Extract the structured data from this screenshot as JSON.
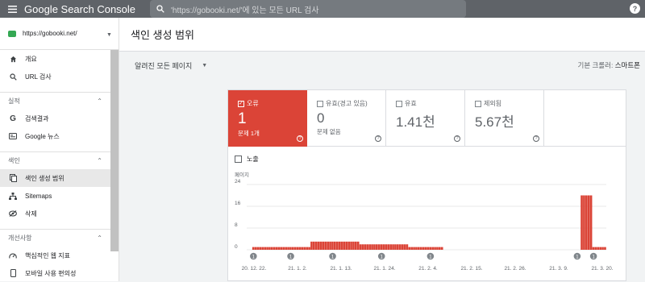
{
  "topbar": {
    "brand": "Google Search Console",
    "search_placeholder": "'https://gobooki.net/'에 있는 모든 URL 검사",
    "help": "?"
  },
  "sidebar": {
    "property": "https://gobooki.net/",
    "items_top": [
      {
        "label": "개요",
        "icon": "home-icon"
      },
      {
        "label": "URL 검사",
        "icon": "search-icon"
      }
    ],
    "sections": [
      {
        "title": "실적",
        "items": [
          {
            "label": "검색결과",
            "icon": "google-g-icon"
          },
          {
            "label": "Google 뉴스",
            "icon": "news-icon"
          }
        ]
      },
      {
        "title": "색인",
        "items": [
          {
            "label": "색인 생성 범위",
            "icon": "coverage-icon"
          },
          {
            "label": "Sitemaps",
            "icon": "sitemap-icon"
          },
          {
            "label": "삭제",
            "icon": "removal-icon"
          }
        ]
      },
      {
        "title": "개선사항",
        "items": [
          {
            "label": "핵심적인 웹 지표",
            "icon": "speed-icon"
          },
          {
            "label": "모바일 사용 편의성",
            "icon": "mobile-icon"
          }
        ]
      }
    ]
  },
  "main": {
    "title": "색인 생성 범위",
    "filter": "알려진 모든 페이지",
    "crawler_label": "기본 크롤러:",
    "crawler_value": "스마트폰"
  },
  "tiles": [
    {
      "label": "오류",
      "value": "1",
      "sub": "문제 1개",
      "selected": true
    },
    {
      "label": "유효(경고 있음)",
      "value": "0",
      "sub": "문제 없음",
      "selected": false
    },
    {
      "label": "유효",
      "value": "1.41천",
      "sub": "",
      "selected": false
    },
    {
      "label": "제외됨",
      "value": "5.67천",
      "sub": "",
      "selected": false
    }
  ],
  "impressions_label": "노출",
  "colors": {
    "error": "#db4437",
    "topbar": "#5f6368"
  },
  "chart_data": {
    "type": "bar",
    "ylabel": "페이지",
    "yticks": [
      0,
      8,
      16,
      24
    ],
    "ylim": [
      0,
      24
    ],
    "xtick_labels": [
      "20. 12. 22.",
      "21. 1. 2.",
      "21. 1. 13.",
      "21. 1. 24.",
      "21. 2. 4.",
      "21. 2. 15.",
      "21. 2. 26.",
      "21. 3. 9.",
      "21. 3. 20."
    ],
    "series": [
      {
        "values": [
          0,
          1,
          1,
          1,
          1,
          1,
          1,
          1,
          1,
          1,
          1,
          1,
          1,
          1,
          1,
          1,
          1,
          1,
          1,
          1,
          1,
          1,
          1,
          1,
          1,
          1,
          3,
          3,
          3,
          3,
          3,
          3,
          3,
          3,
          3,
          3,
          3,
          3,
          3,
          3,
          3,
          3,
          3,
          3,
          3,
          3,
          3,
          2,
          2,
          2,
          2,
          2,
          2,
          2,
          2,
          2,
          2,
          2,
          2,
          2,
          2,
          2,
          2,
          2,
          2,
          2,
          2,
          2,
          1,
          1,
          1,
          1,
          1,
          1,
          1,
          1,
          1,
          1,
          1,
          1,
          1,
          1,
          1,
          0,
          0,
          0,
          0,
          0,
          0,
          0,
          0,
          0,
          0,
          0,
          0,
          0,
          0,
          0,
          0,
          0,
          0,
          0,
          0,
          0,
          0,
          0,
          0,
          0,
          0,
          0,
          0,
          0,
          0,
          0,
          0,
          0,
          0,
          0,
          0,
          0,
          0,
          0,
          0,
          0,
          0,
          0,
          0,
          0,
          0,
          0,
          0,
          0,
          0,
          0,
          0,
          0,
          0,
          0,
          0,
          0,
          0,
          0,
          20,
          20,
          20,
          20,
          20,
          1,
          1,
          1,
          1,
          1,
          1
        ]
      }
    ],
    "annotations": [
      "1",
      "1",
      "1",
      "1",
      "1",
      "1",
      "1"
    ],
    "annotation_index": [
      1,
      17,
      35,
      56,
      77,
      140,
      147
    ]
  }
}
